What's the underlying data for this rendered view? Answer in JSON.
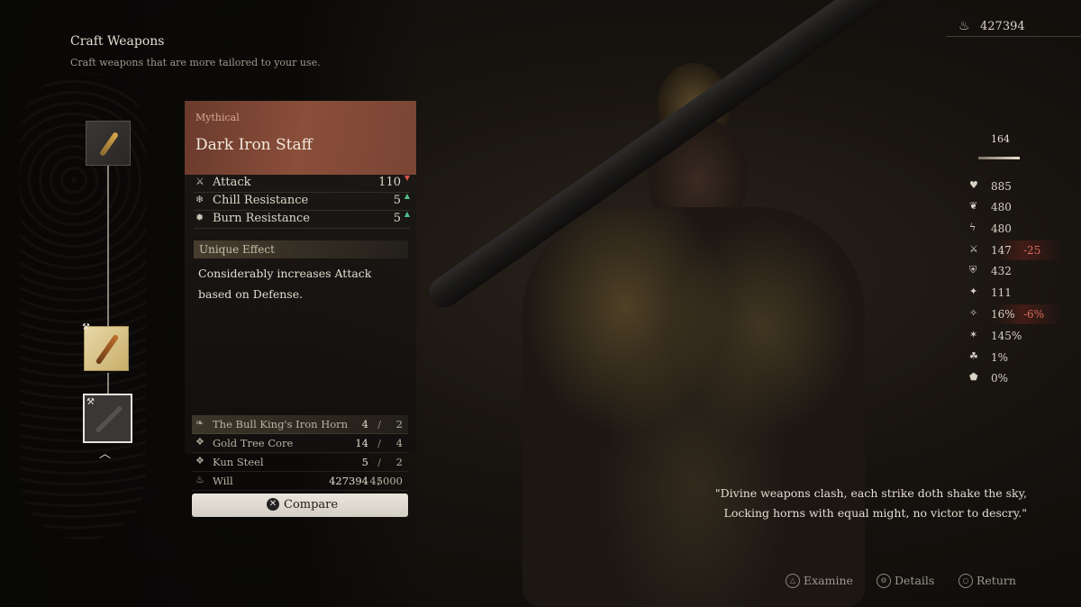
{
  "header": {
    "title": "Craft Weapons",
    "subtitle": "Craft weapons that are more tailored to your use."
  },
  "currency": {
    "icon": "will-icon",
    "value": "427394"
  },
  "weapon": {
    "rarity": "Mythical",
    "name": "Dark Iron Staff",
    "rarity_color": "#7a4534",
    "stats": [
      {
        "icon": "attack-icon",
        "label": "Attack",
        "value": "110",
        "trend": "down"
      },
      {
        "icon": "chill-resistance-icon",
        "label": "Chill Resistance",
        "value": "5",
        "trend": "up"
      },
      {
        "icon": "burn-resistance-icon",
        "label": "Burn Resistance",
        "value": "5",
        "trend": "up"
      }
    ],
    "unique_effect_title": "Unique Effect",
    "unique_effect_text": "Considerably increases Attack based on Defense."
  },
  "materials": [
    {
      "icon": "horn-icon",
      "label": "The Bull King's Iron Horn",
      "have": "4",
      "need": "2"
    },
    {
      "icon": "material-icon",
      "label": "Gold Tree Core",
      "have": "14",
      "need": "4"
    },
    {
      "icon": "material-icon",
      "label": "Kun Steel",
      "have": "5",
      "need": "2"
    },
    {
      "icon": "will-icon",
      "label": "Will",
      "have": "427394",
      "need": "45000"
    }
  ],
  "separator": "/",
  "compare": {
    "button_glyph": "✕",
    "label": "Compare"
  },
  "player_stats": {
    "power": "164",
    "rows": [
      {
        "icon": "health-icon",
        "value": "885",
        "delta": ""
      },
      {
        "icon": "mana-icon",
        "value": "480",
        "delta": ""
      },
      {
        "icon": "stamina-icon",
        "value": "480",
        "delta": ""
      },
      {
        "icon": "attack-icon",
        "value": "147",
        "delta": "-25"
      },
      {
        "icon": "defense-icon",
        "value": "432",
        "delta": ""
      },
      {
        "icon": "focus-icon",
        "value": "111",
        "delta": ""
      },
      {
        "icon": "crit-chance-icon",
        "value": "16%",
        "delta": "-6%"
      },
      {
        "icon": "crit-damage-icon",
        "value": "145%",
        "delta": ""
      },
      {
        "icon": "spirit-icon",
        "value": "1%",
        "delta": ""
      },
      {
        "icon": "resistance-icon",
        "value": "0%",
        "delta": ""
      }
    ]
  },
  "quote": {
    "line1": "\"Divine weapons clash, each strike doth shake the sky,",
    "line2": "Locking horns with equal might, no victor to descry.\""
  },
  "hints": [
    {
      "glyph": "△",
      "label": "Examine"
    },
    {
      "glyph": "⚙",
      "label": "Details"
    },
    {
      "glyph": "○",
      "label": "Return"
    }
  ],
  "colors": {
    "accent": "#d96a5c",
    "up": "#4fbf8a",
    "down": "#d9544a"
  }
}
